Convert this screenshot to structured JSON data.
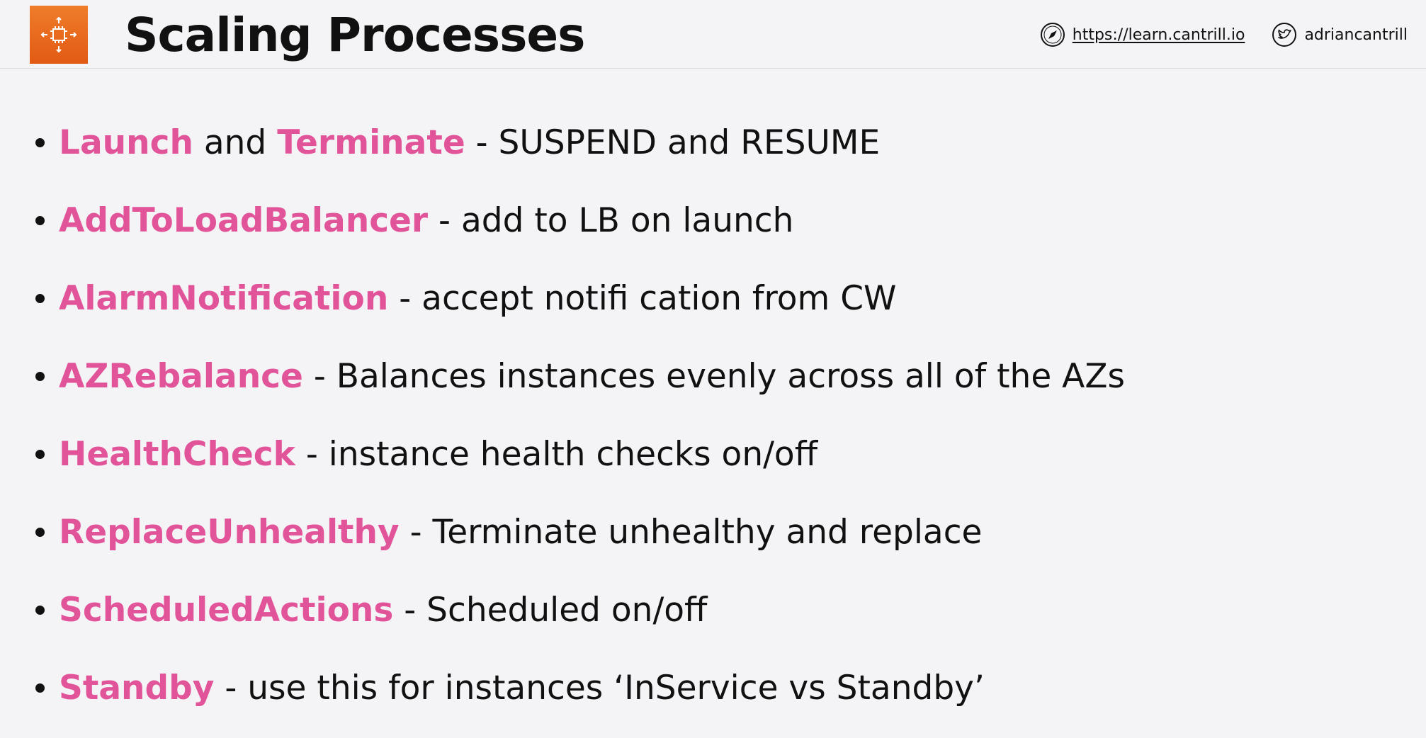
{
  "header": {
    "title": "Scaling Processes",
    "site_link": "https://learn.cantrill.io",
    "twitter_handle": "adriancantrill"
  },
  "colors": {
    "accent": "#e2549a",
    "logo": "#e8641a",
    "background": "#f4f4f6"
  },
  "icons": {
    "logo": "auto-scaling-icon",
    "site": "compass-icon",
    "social": "twitter-icon"
  },
  "bullets": [
    {
      "parts": [
        {
          "text": "Launch",
          "kw": true
        },
        {
          "text": " and ",
          "kw": false
        },
        {
          "text": "Terminate",
          "kw": true
        },
        {
          "text": " - SUSPEND and RESUME",
          "kw": false
        }
      ]
    },
    {
      "parts": [
        {
          "text": "AddToLoadBalancer",
          "kw": true
        },
        {
          "text": " - add to LB on launch",
          "kw": false
        }
      ]
    },
    {
      "parts": [
        {
          "text": "AlarmNotification",
          "kw": true
        },
        {
          "text": " - accept notifi cation from CW",
          "kw": false
        }
      ]
    },
    {
      "parts": [
        {
          "text": "AZRebalance",
          "kw": true
        },
        {
          "text": " - Balances instances evenly across all of the AZs",
          "kw": false
        }
      ]
    },
    {
      "parts": [
        {
          "text": "HealthCheck",
          "kw": true
        },
        {
          "text": " - instance health checks on/off",
          "kw": false
        }
      ]
    },
    {
      "parts": [
        {
          "text": "ReplaceUnhealthy",
          "kw": true
        },
        {
          "text": " - Terminate unhealthy and replace",
          "kw": false
        }
      ]
    },
    {
      "parts": [
        {
          "text": "ScheduledActions",
          "kw": true
        },
        {
          "text": " - Scheduled on/off",
          "kw": false
        }
      ]
    },
    {
      "parts": [
        {
          "text": "Standby",
          "kw": true
        },
        {
          "text": " - use this for instances ‘InService vs Standby’",
          "kw": false
        }
      ]
    }
  ]
}
